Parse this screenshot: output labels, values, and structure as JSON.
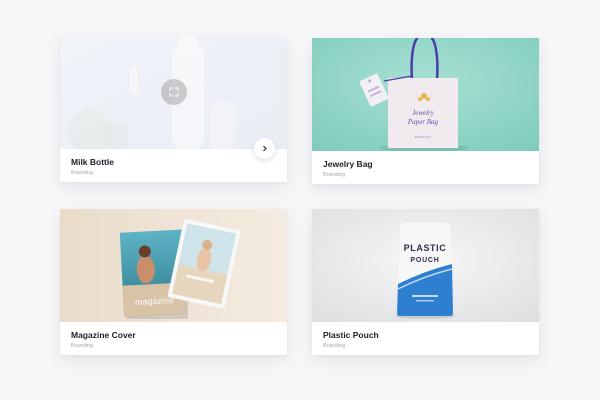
{
  "cards": [
    {
      "title": "Milk Bottle",
      "category": "Branding",
      "overlay_icon": "expand-icon",
      "next_icon": "chevron-right-icon"
    },
    {
      "title": "Jewelry Bag",
      "category": "Branding",
      "image_text": [
        "Jewelry",
        "Paper Bag",
        "MOCKUP"
      ]
    },
    {
      "title": "Magazine Cover",
      "category": "Branding",
      "image_text": [
        "magazine"
      ]
    },
    {
      "title": "Plastic Pouch",
      "category": "Branding",
      "image_text": [
        "PLASTIC",
        "POUCH"
      ]
    }
  ],
  "colors": {
    "page_bg": "#f7f7f9",
    "card_bg": "#ffffff",
    "title": "#1f1f28",
    "category": "#a6a6b2",
    "jewelry_bg": "#8fd4c6",
    "pouch_accent": "#2f7fd0"
  }
}
